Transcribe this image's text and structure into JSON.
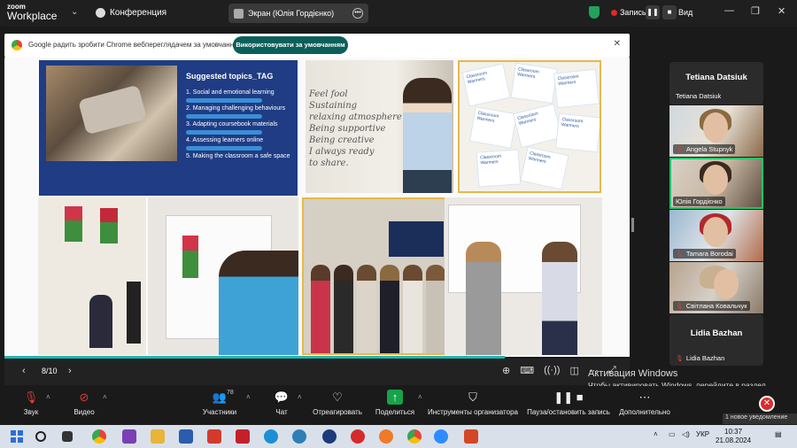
{
  "app": {
    "logo_line1": "zoom",
    "logo_line2": "Workplace",
    "conference_label": "Конференция"
  },
  "share_pill": {
    "label": "Экран (Юлія Гордієнко)"
  },
  "recording": {
    "label": "Запись..."
  },
  "view_label": "Вид",
  "chrome_prompt": {
    "text": "Google радить зробити Chrome веб­переглядачем за умовчанням",
    "button": "Використовувати за умовчанням",
    "close": "✕"
  },
  "slide": {
    "title": "Suggested topics_TAG",
    "topics": [
      "1.   Social and emotional learning",
      "2.   Managing challenging behaviours",
      "3.   Adapting coursebook materials",
      "4.   Assessing learners online",
      "5.   Making the classroom a safe space"
    ],
    "whiteboard_text": "Feel fool\nSustaining\nrelaxing atmosphere\nBeing supportive\nBeing creative\nI always ready\nto share.",
    "card_text": "Classroom Warmers",
    "counter": "8/10",
    "progress": 0.8
  },
  "participants": [
    {
      "type": "name",
      "big": "Tetiana Datsiuk",
      "label": "Tetiana Datsiuk",
      "muted": false
    },
    {
      "type": "video",
      "label": "Angela Stupnyk",
      "muted": true,
      "active": false
    },
    {
      "type": "video",
      "label": "Юлія Гордієнко",
      "muted": false,
      "active": true
    },
    {
      "type": "video",
      "label": "Tamara Borodai",
      "muted": true,
      "active": false
    },
    {
      "type": "video",
      "label": "Світлана Ковальчук",
      "muted": true,
      "active": false
    },
    {
      "type": "name",
      "big": "Lidia Bazhan",
      "label": "Lidia Bazhan",
      "muted": true
    }
  ],
  "toolbar": {
    "audio": "Звук",
    "video": "Видео",
    "participants": "Участники",
    "participants_count": "78",
    "chat": "Чат",
    "react": "Отреагировать",
    "share": "Поделиться",
    "host_tools": "Инструменты организатора",
    "pause_record": "Пауза/остановить запись",
    "more": "Дополнительно"
  },
  "activation": {
    "title": "Активация Windows",
    "body": "Чтобы активировать Windows, перейдите в раздел \"Параметры\"."
  },
  "notification": "1 новое уведомление",
  "taskbar": {
    "lang": "УКР",
    "time": "10:37",
    "date": "21.08.2024"
  },
  "colors": {
    "accent": "#0b5f5a",
    "share_green": "#16a34a",
    "end_red": "#d92c2c",
    "progress": "#21b5b0"
  }
}
